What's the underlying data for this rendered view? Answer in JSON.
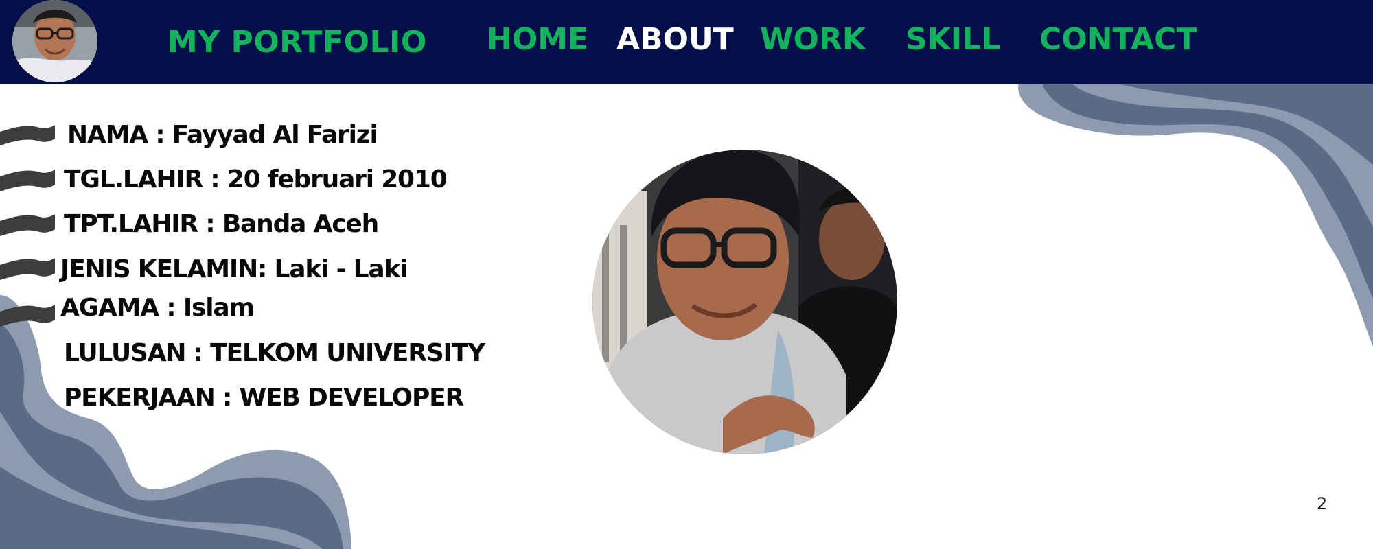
{
  "header": {
    "brand": "MY PORTFOLIO",
    "nav": [
      {
        "label": "HOME",
        "active": false
      },
      {
        "label": "ABOUT",
        "active": true
      },
      {
        "label": "WORK",
        "active": false
      },
      {
        "label": "SKILL",
        "active": false
      },
      {
        "label": "CONTACT",
        "active": false
      }
    ]
  },
  "profile": {
    "fields": [
      "NAMA : Fayyad Al Farizi",
      "TGL.LAHIR : 20 februari 2010",
      "TPT.LAHIR : Banda Aceh",
      "JENIS KELAMIN: Laki - Laki",
      "AGAMA : Islam",
      "LULUSAN : TELKOM UNIVERSITY",
      "PEKERJAAN : WEB DEVELOPER"
    ]
  },
  "slide": {
    "page_number": "2"
  },
  "colors": {
    "navbar_bg": "#020f48",
    "nav_link": "#12b35c",
    "nav_active": "#ffffff",
    "wave_dark": "#5a6b88",
    "wave_light": "#8d9ab0",
    "bullet": "#3d3d3d"
  },
  "icons": {
    "bullet": "wave-bullet-icon"
  }
}
